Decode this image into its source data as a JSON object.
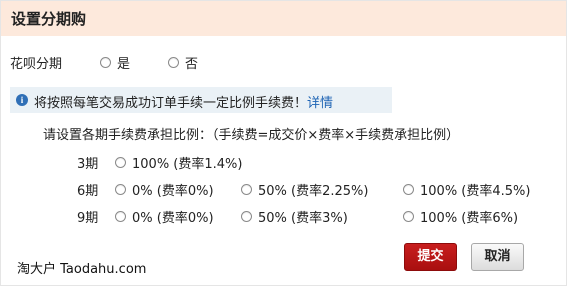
{
  "header": {
    "title": "设置分期购"
  },
  "installment": {
    "label": "花呗分期",
    "options": [
      "是",
      "否"
    ]
  },
  "notice": {
    "text": "将按照每笔交易成功订单手续一定比例手续费！",
    "link": "详情"
  },
  "instruction": "请设置各期手续费承担比例：（手续费=成交价×费率×手续费承担比例）",
  "periods": [
    {
      "label": "3期",
      "options": [
        "100% (费率1.4%)"
      ]
    },
    {
      "label": "6期",
      "options": [
        "0% (费率0%)",
        "50% (费率2.25%)",
        "100% (费率4.5%)"
      ]
    },
    {
      "label": "9期",
      "options": [
        "0% (费率0%)",
        "50% (费率3%)",
        "100% (费率6%)"
      ]
    }
  ],
  "buttons": {
    "submit": "提交",
    "cancel": "取消"
  },
  "watermark": "淘大户 Taodahu.com",
  "colors": {
    "header_bg": "#fde9dc",
    "notice_bg": "#eaf1f6",
    "link": "#1e64b4",
    "submit_bg": "#b81414"
  }
}
